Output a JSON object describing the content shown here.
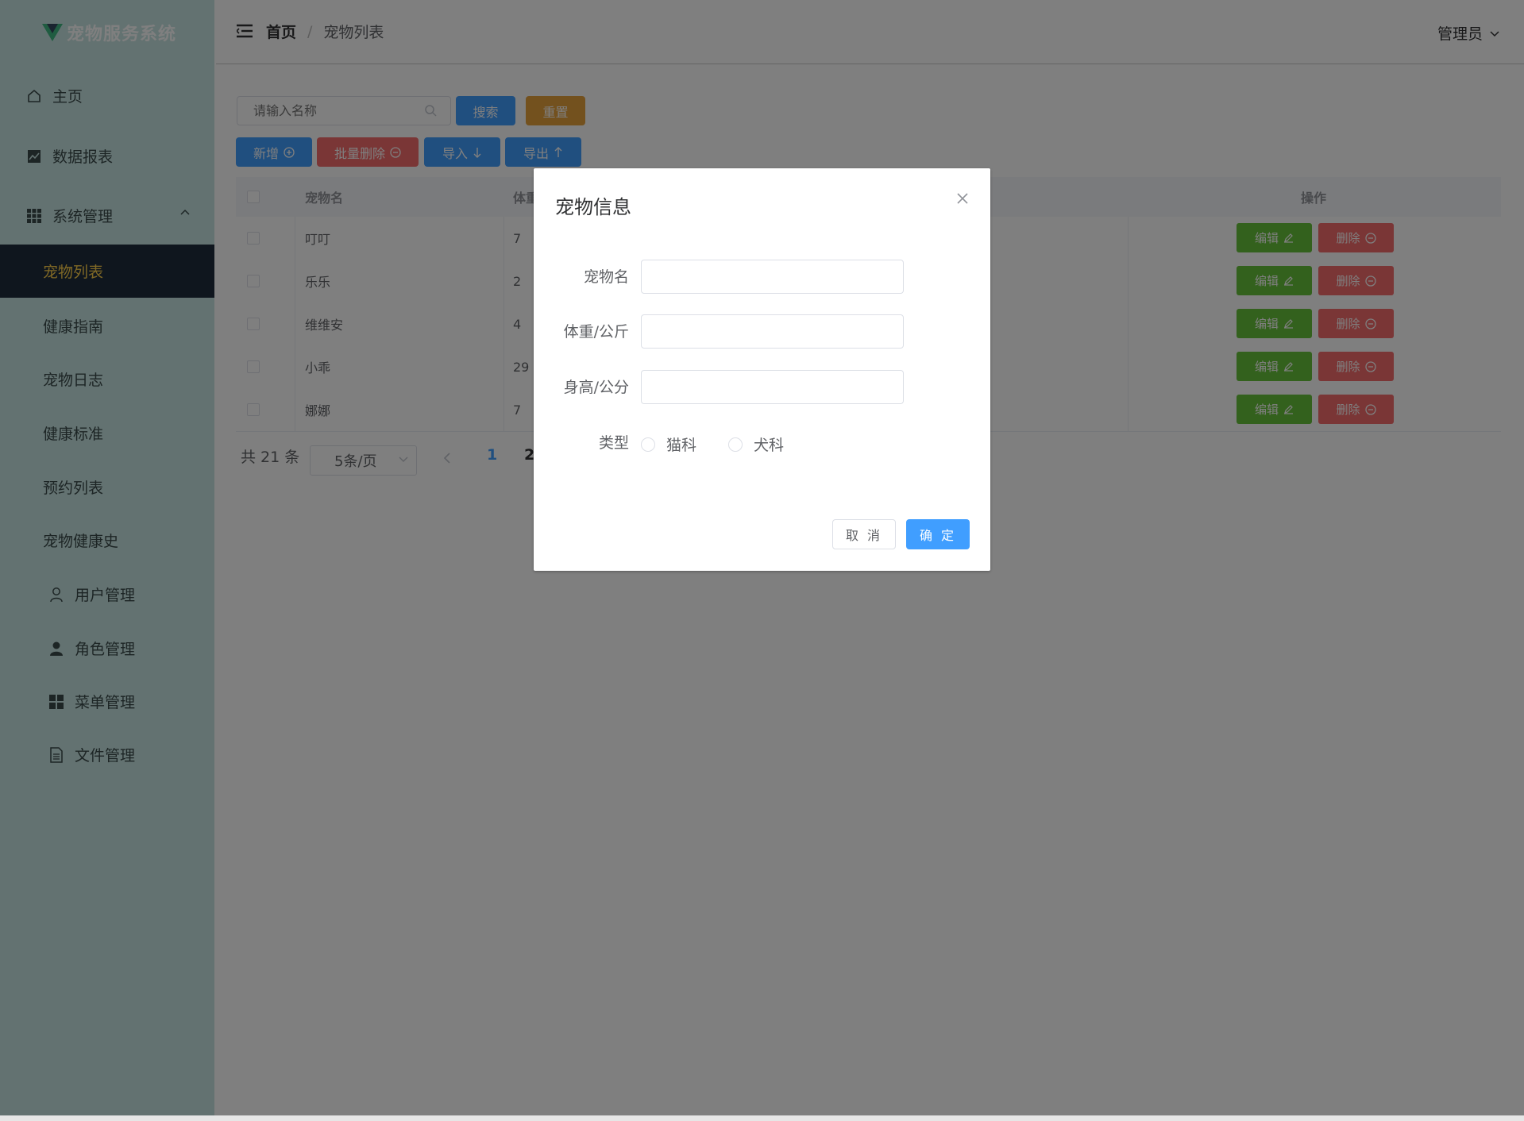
{
  "app": {
    "title": "宠物服务系统"
  },
  "sidebar": {
    "items": [
      {
        "label": "主页",
        "icon": "house-icon"
      },
      {
        "label": "数据报表",
        "icon": "chart-icon"
      },
      {
        "label": "系统管理",
        "icon": "grid-icon",
        "expanded": true
      },
      {
        "label": "宠物列表",
        "active": true
      },
      {
        "label": "健康指南"
      },
      {
        "label": "宠物日志"
      },
      {
        "label": "健康标准"
      },
      {
        "label": "预约列表"
      },
      {
        "label": "宠物健康史"
      },
      {
        "label": "用户管理",
        "icon": "user-icon"
      },
      {
        "label": "角色管理",
        "icon": "user-filled-icon"
      },
      {
        "label": "菜单管理",
        "icon": "menu-grid-icon"
      },
      {
        "label": "文件管理",
        "icon": "document-icon"
      }
    ]
  },
  "header": {
    "breadcrumb_home": "首页",
    "breadcrumb_sep": "/",
    "breadcrumb_current": "宠物列表",
    "user": "管理员"
  },
  "toolbar": {
    "search_placeholder": "请输入名称",
    "search": "搜索",
    "reset": "重置",
    "add": "新增",
    "batch_delete": "批量删除",
    "import": "导入",
    "export": "导出"
  },
  "table": {
    "columns": {
      "name": "宠物名",
      "weight": "体重",
      "ops": "操作"
    },
    "rows": [
      {
        "name": "叮叮",
        "weight": "7"
      },
      {
        "name": "乐乐",
        "weight": "2"
      },
      {
        "name": "维维安",
        "weight": "4"
      },
      {
        "name": "小乖",
        "weight": "29"
      },
      {
        "name": "娜娜",
        "weight": "7"
      }
    ],
    "edit": "编辑",
    "delete": "删除"
  },
  "pagination": {
    "total": "共 21 条",
    "page_size": "5条/页",
    "pages": [
      "1",
      "2"
    ],
    "current": "1"
  },
  "dialog": {
    "title": "宠物信息",
    "fields": {
      "name": {
        "label": "宠物名",
        "value": ""
      },
      "weight": {
        "label": "体重/公斤",
        "value": ""
      },
      "height": {
        "label": "身高/公分",
        "value": ""
      },
      "type": {
        "label": "类型",
        "options": [
          "猫科",
          "犬科"
        ]
      }
    },
    "cancel": "取 消",
    "confirm": "确 定"
  },
  "colors": {
    "sidebar_bg": "#c7e5e3",
    "active_bg": "#1f2d3d",
    "active_text": "#ffd04b",
    "primary": "#409eff",
    "warning": "#e6a23c",
    "danger": "#f56c6c",
    "success": "#67c23a"
  }
}
